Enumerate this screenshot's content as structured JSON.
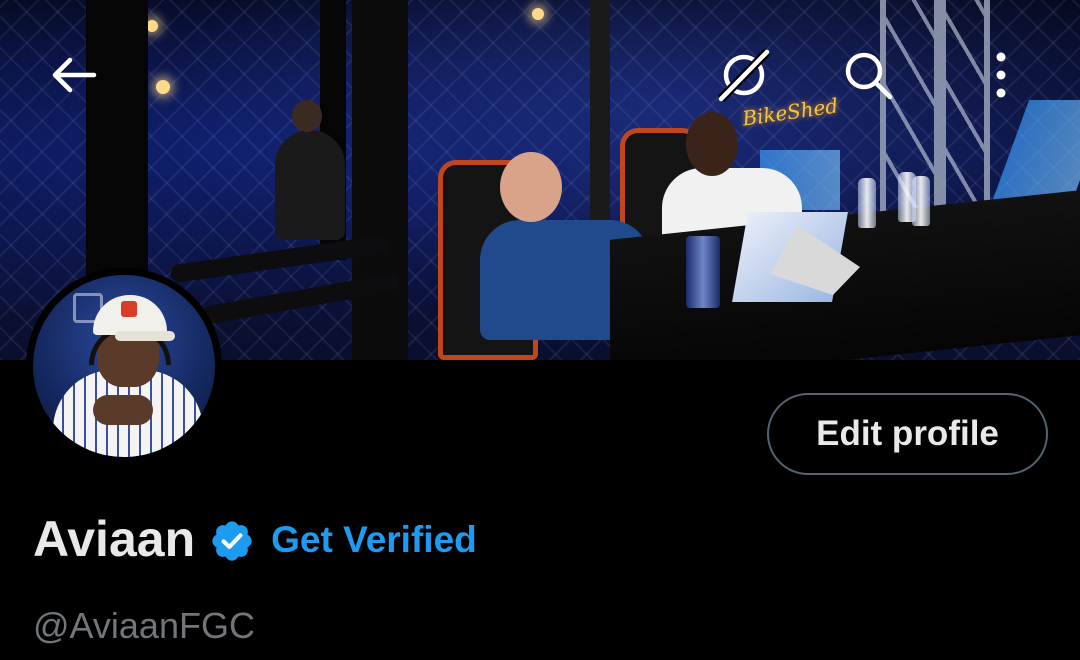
{
  "profile": {
    "display_name": "Aviaan",
    "handle": "@AviaanFGC",
    "get_verified_label": "Get Verified",
    "edit_profile_label": "Edit profile"
  },
  "topbar": {
    "icons": [
      "back-arrow-icon",
      "grok-icon",
      "search-icon",
      "more-vertical-icon"
    ]
  },
  "banner": {
    "sign_text": "BikeShed"
  },
  "colors": {
    "background": "#000000",
    "text_primary": "#e7e9ea",
    "text_secondary": "#71767b",
    "accent_blue": "#1d9bf0",
    "button_border": "#536471"
  }
}
